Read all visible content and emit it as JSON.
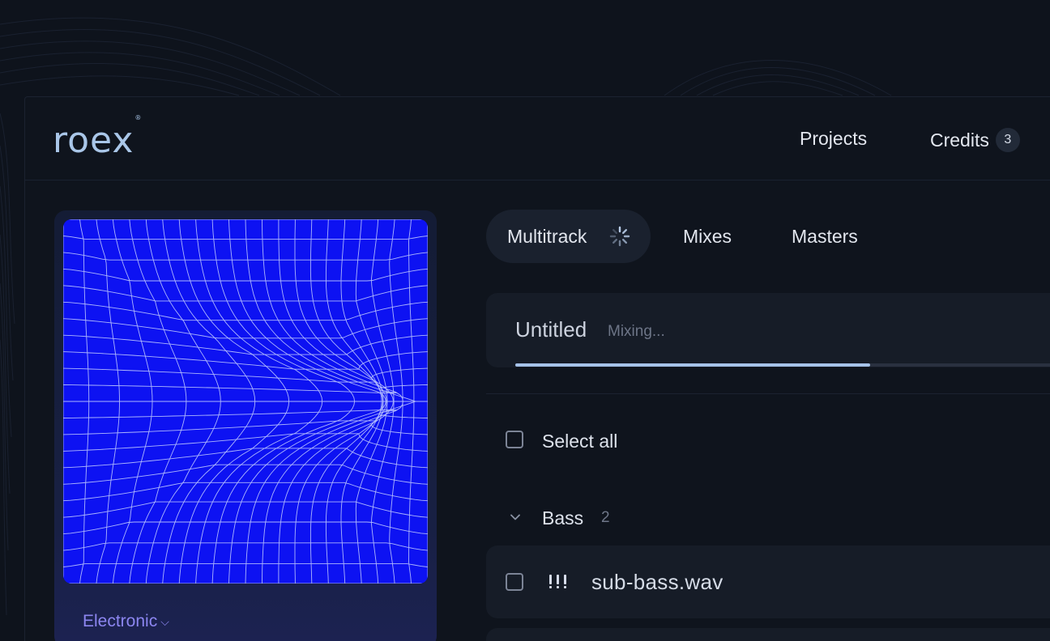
{
  "brand": {
    "logo_text": "roex",
    "logo_mark": "®"
  },
  "nav": {
    "projects_label": "Projects",
    "credits_label": "Credits",
    "credits_count": "3"
  },
  "artwork": {
    "genre_label": "Electronic",
    "genre_icon": "chevron-down-icon"
  },
  "tabs": [
    {
      "label": "Multitrack",
      "active": true,
      "loading": true
    },
    {
      "label": "Mixes",
      "active": false
    },
    {
      "label": "Masters",
      "active": false
    }
  ],
  "project": {
    "title": "Untitled",
    "status": "Mixing...",
    "progress": 0.66
  },
  "select_all_label": "Select all",
  "groups": [
    {
      "name": "Bass",
      "count": "2",
      "tracks": [
        {
          "name": "sub-bass.wav",
          "icon": "drag-handle-icon"
        }
      ]
    }
  ],
  "colors": {
    "background": "#0e131c",
    "panel": "#161c27",
    "accent": "#a6c2e9",
    "artwork_blue": "#0d12f2",
    "genre_text": "#8c86f0"
  }
}
